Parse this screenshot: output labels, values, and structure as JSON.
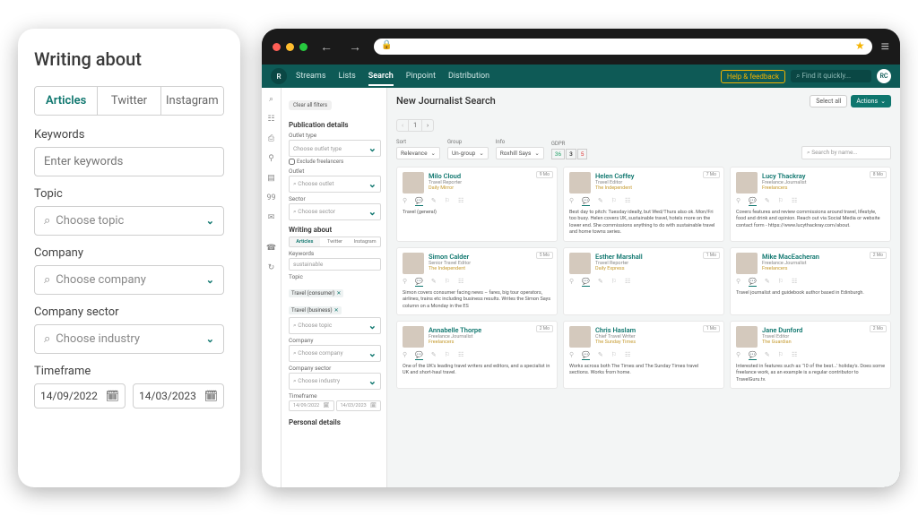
{
  "left": {
    "heading": "Writing about",
    "tabs": [
      "Articles",
      "Twitter",
      "Instagram"
    ],
    "active_tab": 0,
    "keywords_label": "Keywords",
    "keywords_placeholder": "Enter keywords",
    "topic_label": "Topic",
    "topic_placeholder": "Choose topic",
    "company_label": "Company",
    "company_placeholder": "Choose company",
    "sector_label": "Company sector",
    "sector_placeholder": "Choose industry",
    "timeframe_label": "Timeframe",
    "date_from": "14/09/2022",
    "date_to": "14/03/2023"
  },
  "browser": {
    "back": "←",
    "forward": "→",
    "lock": "🔒",
    "star": "★",
    "menu": "≡"
  },
  "app": {
    "brand": "R",
    "nav": [
      "Streams",
      "Lists",
      "Search",
      "Pinpoint",
      "Distribution"
    ],
    "nav_active": 2,
    "help": "Help & feedback",
    "quick_search_placeholder": "⌕ Find it quickly...",
    "avatar": "RC"
  },
  "rail_icons": [
    "⌕",
    "☷",
    "⎙",
    "⚲",
    "▤",
    "99",
    "✉",
    "",
    "☎",
    "↻"
  ],
  "sidebar": {
    "clear": "Clear all filters",
    "pub_title": "Publication details",
    "outlet_type_lbl": "Outlet type",
    "outlet_type_placeholder": "Choose outlet type",
    "exclude_freelancers": "Exclude freelancers",
    "outlet_lbl": "Outlet",
    "outlet_placeholder": "⌕ Choose outlet",
    "sector_lbl": "Sector",
    "sector_placeholder": "⌕ Choose sector",
    "writing_title": "Writing about",
    "mini_tabs": [
      "Articles",
      "Twitter",
      "Instagram"
    ],
    "keywords_lbl": "Keywords",
    "keyword_value": "sustainable",
    "topic_lbl": "Topic",
    "topic_tags": [
      "Travel (consumer)",
      "Travel (business)"
    ],
    "topic_placeholder": "⌕ Choose topic",
    "company_lbl": "Company",
    "company_placeholder": "⌕ Choose company",
    "csector_lbl": "Company sector",
    "csector_placeholder": "⌕ Choose industry",
    "timeframe_lbl": "Timeframe",
    "date_from": "14/09/2022",
    "date_to": "14/03/2023",
    "personal_title": "Personal details"
  },
  "main": {
    "title": "New Journalist Search",
    "pager_prev": "‹",
    "pager_page": "1",
    "pager_next": "›",
    "select_all": "Select all",
    "actions": "Actions",
    "sort_lbl": "Sort",
    "sort_val": "Relevance",
    "group_lbl": "Group",
    "group_val": "Un-group",
    "info_lbl": "Info",
    "info_val": "Roxhill Says",
    "gdpr_lbl": "GDPR",
    "gdpr_vals": [
      "36",
      "3",
      "5"
    ],
    "name_search_placeholder": "⌕ Search by name...",
    "cards": [
      {
        "name": "Milo Cloud",
        "role": "Travel Reporter",
        "outlet": "Daily Mirror",
        "badge": "9 Mo",
        "bio": "Travel (general)"
      },
      {
        "name": "Helen Coffey",
        "role": "Travel Editor",
        "outlet": "The Independent",
        "badge": "7 Mo",
        "bio": "Best day to pitch: Tuesday ideally, but Wed/Thurs also ok. Mon/Fri too busy. Helen covers UK, sustainable travel, hotels more on the lower end. She commissions anything to do with sustainable travel and home towns series."
      },
      {
        "name": "Lucy Thackray",
        "role": "Freelance Journalist",
        "outlet": "Freelancers",
        "badge": "8 Mo",
        "bio": "Covers features and review commissions around travel, lifestyle, food and drink and opinion. Reach out via Social Media or website contact form - https://www.lucythackray.com/about."
      },
      {
        "name": "Simon Calder",
        "role": "Senior Travel Editor",
        "outlet": "The Independent",
        "badge": "5 Mo",
        "bio": "Simon covers consumer facing news – fares, big tour operators, airlines, trains etc including business results. Writes the Simon Says column on a Monday in the ES"
      },
      {
        "name": "Esther Marshall",
        "role": "Travel Reporter",
        "outlet": "Daily Express",
        "badge": "1 Mo",
        "bio": ""
      },
      {
        "name": "Mike MacEacheran",
        "role": "Freelance Journalist",
        "outlet": "Freelancers",
        "badge": "2 Mo",
        "bio": "Travel journalist and guidebook author based in Edinburgh."
      },
      {
        "name": "Annabelle Thorpe",
        "role": "Freelance Journalist",
        "outlet": "Freelancers",
        "badge": "2 Mo",
        "bio": "One of the UK's leading travel writers and editors, and a specialist in UK and short-haul travel."
      },
      {
        "name": "Chris Haslam",
        "role": "Chief Travel Writer",
        "outlet": "The Sunday Times",
        "badge": "1 Mo",
        "bio": "Works across both The Times and The Sunday Times travel sections. Works from home."
      },
      {
        "name": "Jane Dunford",
        "role": "Travel Editor",
        "outlet": "The Guardian",
        "badge": "2 Mo",
        "bio": "Interested in features such as '10 of the best...' holiday's. Does some freelance work, as an example is a regular contributor to TravelGuru.tv."
      }
    ]
  },
  "icons_row": [
    "⚲",
    "💬",
    "✎",
    "⚐",
    "☷"
  ]
}
